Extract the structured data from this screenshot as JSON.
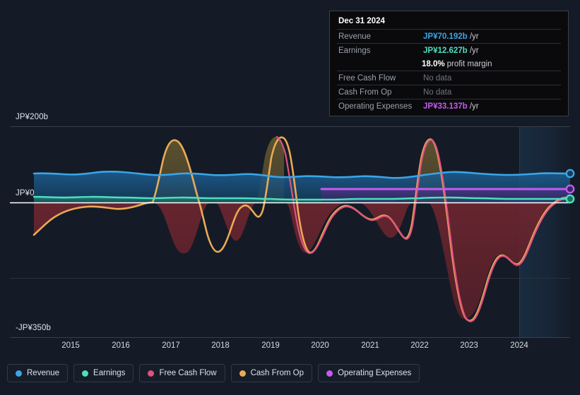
{
  "tooltip": {
    "date": "Dec 31 2024",
    "rows": [
      {
        "label": "Revenue",
        "value": "JP¥70.192b",
        "unit": "/yr",
        "color": "#3aa6e8",
        "nodata": false
      },
      {
        "label": "Earnings",
        "value": "JP¥12.627b",
        "unit": "/yr",
        "color": "#4ae0c0",
        "nodata": false
      },
      {
        "label": "Free Cash Flow",
        "value": "No data",
        "unit": "",
        "color": "#e0527f",
        "nodata": true
      },
      {
        "label": "Cash From Op",
        "value": "No data",
        "unit": "",
        "color": "#eaaa54",
        "nodata": true
      },
      {
        "label": "Operating Expenses",
        "value": "JP¥33.137b",
        "unit": "/yr",
        "color": "#c45bf0",
        "nodata": false
      }
    ],
    "margin_pct": "18.0%",
    "margin_text": "profit margin"
  },
  "legend": {
    "items": [
      {
        "label": "Revenue",
        "color": "#3aa6e8"
      },
      {
        "label": "Earnings",
        "color": "#4ae0c0"
      },
      {
        "label": "Free Cash Flow",
        "color": "#e0527f"
      },
      {
        "label": "Cash From Op",
        "color": "#eaaa54"
      },
      {
        "label": "Operating Expenses",
        "color": "#c45bf0"
      }
    ]
  },
  "axis": {
    "y_top": "JP¥200b",
    "y_zero": "JP¥0",
    "y_bottom": "-JP¥350b",
    "x_labels": [
      "2015",
      "2016",
      "2017",
      "2018",
      "2019",
      "2020",
      "2021",
      "2022",
      "2023",
      "2024"
    ]
  },
  "chart_data": {
    "type": "line",
    "title": "",
    "xlabel": "",
    "ylabel": "",
    "ylim": [
      -350,
      200
    ],
    "y_ticks": [
      200,
      0,
      -350
    ],
    "y_tick_labels": [
      "JP¥200b",
      "JP¥0",
      "-JP¥350b"
    ],
    "currency": "JP¥",
    "units": "billions",
    "grid": true,
    "legend_position": "bottom",
    "x_tick_labels": [
      "2015",
      "2016",
      "2017",
      "2018",
      "2019",
      "2020",
      "2021",
      "2022",
      "2023",
      "2024"
    ],
    "x_range": [
      "2014.3",
      "2025.3"
    ],
    "forecast_start": "2024.3",
    "series": [
      {
        "name": "Revenue",
        "color": "#3aa6e8",
        "x": [
          2014.3,
          2014.8,
          2015.3,
          2015.8,
          2016.3,
          2016.8,
          2017.3,
          2017.8,
          2018.3,
          2018.8,
          2019.3,
          2019.8,
          2020.3,
          2020.8,
          2021.3,
          2021.8,
          2022.3,
          2022.8,
          2023.3,
          2023.8,
          2024.3,
          2024.8,
          2025.3
        ],
        "values": [
          74,
          73,
          71,
          72,
          74,
          72,
          73,
          73,
          71,
          70,
          70,
          72,
          71,
          70,
          69,
          70,
          73,
          72,
          71,
          70,
          70,
          70,
          70.192
        ],
        "last_value": 70.192
      },
      {
        "name": "Earnings",
        "color": "#4ae0c0",
        "x": [
          2014.3,
          2014.8,
          2015.3,
          2015.8,
          2016.3,
          2016.8,
          2017.3,
          2017.8,
          2018.3,
          2018.8,
          2019.3,
          2019.8,
          2020.3,
          2020.8,
          2021.3,
          2021.8,
          2022.3,
          2022.8,
          2023.3,
          2023.8,
          2024.3,
          2024.8,
          2025.3
        ],
        "values": [
          13,
          12,
          12,
          13,
          12,
          12,
          13,
          12,
          12,
          11,
          11,
          10,
          10,
          11,
          10,
          11,
          12,
          12,
          12,
          12,
          12,
          12,
          12.627
        ],
        "last_value": 12.627
      },
      {
        "name": "Free Cash Flow",
        "color": "#e0527f",
        "x": [
          2019.1,
          2019.3,
          2019.5,
          2019.9,
          2020.3,
          2020.8,
          2021.3,
          2021.6,
          2021.9,
          2022.3,
          2022.7,
          2023.0,
          2023.3,
          2023.6,
          2023.9,
          2024.2,
          2024.6,
          2025.0
        ],
        "values": [
          190,
          120,
          -40,
          -155,
          -150,
          -60,
          -5,
          -20,
          -70,
          165,
          -40,
          -250,
          -310,
          -320,
          -300,
          -135,
          -160,
          -20
        ],
        "note": "tracks Cash From Op closely; begins ~2019"
      },
      {
        "name": "Cash From Op",
        "color": "#eaaa54",
        "x": [
          2014.3,
          2014.7,
          2015.2,
          2015.7,
          2016.0,
          2016.4,
          2016.8,
          2017.1,
          2017.4,
          2017.8,
          2018.1,
          2018.4,
          2018.8,
          2019.1,
          2019.4,
          2019.8,
          2020.1,
          2020.5,
          2020.9,
          2021.3,
          2021.6,
          2021.9,
          2022.2,
          2022.5,
          2022.8,
          2023.1,
          2023.4,
          2023.7,
          2024.0,
          2024.3,
          2024.7,
          2025.1
        ],
        "values": [
          -150,
          -120,
          -62,
          -50,
          -48,
          -40,
          -30,
          -35,
          190,
          60,
          -150,
          -110,
          30,
          190,
          150,
          -155,
          -150,
          -90,
          -5,
          -5,
          -30,
          -75,
          180,
          50,
          -250,
          -320,
          -325,
          -300,
          -130,
          -150,
          -110,
          -10
        ]
      },
      {
        "name": "Operating Expenses",
        "color": "#c45bf0",
        "x": [
          2020.0,
          2020.5,
          2021.0,
          2021.5,
          2022.0,
          2022.5,
          2023.0,
          2023.5,
          2024.0,
          2024.5,
          2025.1
        ],
        "values": [
          34,
          34,
          34,
          34,
          34,
          34,
          33,
          33,
          33,
          33,
          33.137
        ],
        "last_value": 33.137
      }
    ]
  }
}
